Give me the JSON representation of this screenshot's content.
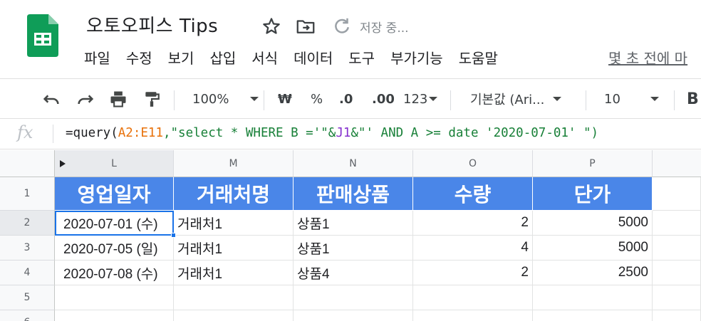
{
  "window": {
    "doc_title": "오토오피스 Tips",
    "save_status": "저장 중..."
  },
  "menu": {
    "items": [
      "파일",
      "수정",
      "보기",
      "삽입",
      "서식",
      "데이터",
      "도구",
      "부가기능",
      "도움말"
    ],
    "last_edit": "몇 초 전에 마"
  },
  "toolbar": {
    "zoom": "100%",
    "currency": "₩",
    "percent": "%",
    "decrease_decimal": ".0",
    "increase_decimal": ".00",
    "more_formats": "123",
    "font": "기본값 (Ari...",
    "font_size": "10",
    "bold": "B"
  },
  "formula_bar": {
    "fx": "fx",
    "parts": {
      "p1": "=query(",
      "p2": "A2:E11",
      "p3": ",\"select * WHERE B ='\"&",
      "p4": "J1",
      "p5": "&\"' AND A >= date '2020-07-01' \")"
    }
  },
  "grid": {
    "columns": [
      "L",
      "M",
      "N",
      "O",
      "P"
    ],
    "rows": [
      "1",
      "2",
      "3",
      "4",
      "5",
      "6"
    ],
    "header_row": [
      "영업일자",
      "거래처명",
      "판매상품",
      "수량",
      "단가"
    ],
    "data_rows": [
      [
        "2020-07-01 (수)",
        "거래처1",
        "상품1",
        "2",
        "5000"
      ],
      [
        "2020-07-05 (일)",
        "거래처1",
        "상품1",
        "4",
        "5000"
      ],
      [
        "2020-07-08 (수)",
        "거래처1",
        "상품4",
        "2",
        "2500"
      ]
    ],
    "header_fill": "#4a86e8",
    "selection_color": "#1a73e8"
  }
}
